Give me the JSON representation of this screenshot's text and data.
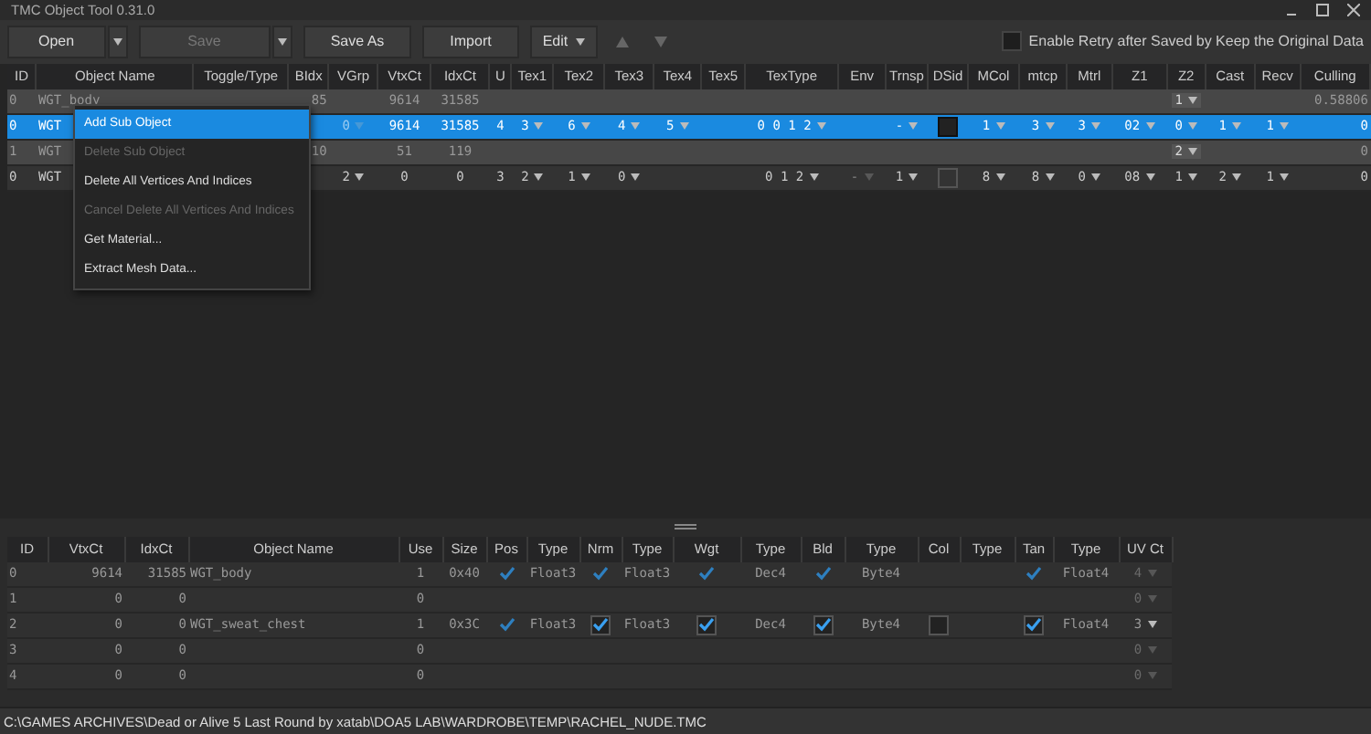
{
  "window": {
    "title": "TMC Object Tool 0.31.0"
  },
  "toolbar": {
    "buttons": [
      {
        "label": "Open",
        "disabled": false,
        "dropdown": true
      },
      {
        "label": "Save",
        "disabled": true,
        "dropdown": true
      },
      {
        "label": "Save As",
        "disabled": false,
        "dropdown": false
      },
      {
        "label": "Import",
        "disabled": false,
        "dropdown": false
      },
      {
        "label": "Edit",
        "disabled": false,
        "dropdown": true,
        "kind": "menu"
      }
    ],
    "retry_option": {
      "label": "Enable Retry after Saved by Keep the Original Data",
      "checked": false
    }
  },
  "objects_table": {
    "columns": [
      "ID",
      "Object Name",
      "Toggle/Type",
      "BIdx",
      "VGrp",
      "VtxCt",
      "IdxCt",
      "U",
      "Tex1",
      "Tex2",
      "Tex3",
      "Tex4",
      "Tex5",
      "TexType",
      "Env",
      "Trnsp",
      "DSid",
      "MCol",
      "mtcp",
      "Mtrl",
      "Z1",
      "Z2",
      "Cast",
      "Recv",
      "Culling"
    ],
    "rows": [
      {
        "kind": "object",
        "selected": false,
        "cells": [
          "0",
          "WGT_body",
          null,
          "85",
          null,
          "9614",
          "31585",
          null,
          null,
          null,
          null,
          null,
          null,
          null,
          null,
          null,
          null,
          null,
          null,
          null,
          null,
          {
            "kind": "dropdown",
            "text": "1"
          },
          null,
          null,
          "0.58806"
        ]
      },
      {
        "kind": "sub",
        "selected": true,
        "cells": [
          "0",
          "WGT",
          null,
          null,
          {
            "kind": "dropdown",
            "text": "0",
            "disabled": true
          },
          "9614",
          "31585",
          "4",
          {
            "kind": "dropdown",
            "text": "3"
          },
          {
            "kind": "dropdown",
            "text": "6"
          },
          {
            "kind": "dropdown",
            "text": "4"
          },
          {
            "kind": "dropdown",
            "text": "5"
          },
          null,
          {
            "kind": "dropdown",
            "text": "0 0 1 2"
          },
          null,
          {
            "kind": "dropdown",
            "text": "-"
          },
          {
            "kind": "swatch",
            "filled": true
          },
          {
            "kind": "dropdown",
            "text": "1"
          },
          {
            "kind": "dropdown",
            "text": "3"
          },
          {
            "kind": "dropdown",
            "text": "3"
          },
          {
            "kind": "dropdown",
            "text": "02"
          },
          {
            "kind": "dropdown",
            "text": "0"
          },
          {
            "kind": "dropdown",
            "text": "1"
          },
          {
            "kind": "dropdown",
            "text": "1"
          },
          "0"
        ]
      },
      {
        "kind": "object",
        "selected": false,
        "cells": [
          "1",
          "WGT",
          null,
          "10",
          null,
          "51",
          "119",
          null,
          null,
          null,
          null,
          null,
          null,
          null,
          null,
          null,
          null,
          null,
          null,
          null,
          null,
          {
            "kind": "dropdown",
            "text": "2"
          },
          null,
          null,
          "0"
        ]
      },
      {
        "kind": "sub",
        "selected": false,
        "cells": [
          "0",
          "WGT",
          null,
          null,
          {
            "kind": "dropdown",
            "text": "2"
          },
          "0",
          "0",
          "3",
          {
            "kind": "dropdown",
            "text": "2"
          },
          {
            "kind": "dropdown",
            "text": "1"
          },
          {
            "kind": "dropdown",
            "text": "0"
          },
          null,
          null,
          {
            "kind": "dropdown",
            "text": "0 1 2"
          },
          {
            "kind": "dropdown",
            "text": "-",
            "disabled": true
          },
          {
            "kind": "dropdown",
            "text": "1"
          },
          {
            "kind": "swatch",
            "filled": false
          },
          {
            "kind": "dropdown",
            "text": "8"
          },
          {
            "kind": "dropdown",
            "text": "8"
          },
          {
            "kind": "dropdown",
            "text": "0"
          },
          {
            "kind": "dropdown",
            "text": "08"
          },
          {
            "kind": "dropdown",
            "text": "1"
          },
          {
            "kind": "dropdown",
            "text": "2"
          },
          {
            "kind": "dropdown",
            "text": "1"
          },
          "0"
        ]
      }
    ]
  },
  "context_menu": {
    "items": [
      {
        "label": "Add Sub Object",
        "disabled": false,
        "selected": true
      },
      {
        "label": "Delete Sub Object",
        "disabled": true,
        "selected": false
      },
      {
        "label": "Delete All Vertices And Indices",
        "disabled": false,
        "selected": false
      },
      {
        "label": "Cancel Delete All Vertices And Indices",
        "disabled": true,
        "selected": false
      },
      {
        "label": "Get Material...",
        "disabled": false,
        "selected": false
      },
      {
        "label": "Extract Mesh Data...",
        "disabled": false,
        "selected": false
      }
    ]
  },
  "meshes_table": {
    "columns": [
      "ID",
      "VtxCt",
      "IdxCt",
      "Object Name",
      "Use",
      "Size",
      "Pos",
      "Type",
      "Nrm",
      "Type",
      "Wgt",
      "Type",
      "Bld",
      "Type",
      "Col",
      "Type",
      "Tan",
      "Type",
      "UV Ct"
    ],
    "rows": [
      {
        "cells": [
          "0",
          "9614",
          "31585",
          "WGT_body",
          "1",
          "0x40",
          {
            "kind": "check",
            "checked": true,
            "boxed": false
          },
          "Float3",
          {
            "kind": "check",
            "checked": true,
            "boxed": false
          },
          "Float3",
          {
            "kind": "check",
            "checked": true,
            "boxed": false
          },
          "Dec4",
          {
            "kind": "check",
            "checked": true,
            "boxed": false
          },
          "Byte4",
          null,
          null,
          {
            "kind": "check",
            "checked": true,
            "boxed": false
          },
          "Float4",
          {
            "kind": "dropdown",
            "text": "4",
            "disabled": true
          }
        ]
      },
      {
        "cells": [
          "1",
          "0",
          "0",
          null,
          "0",
          null,
          null,
          null,
          null,
          null,
          null,
          null,
          null,
          null,
          null,
          null,
          null,
          null,
          {
            "kind": "dropdown",
            "text": "0",
            "disabled": true
          }
        ]
      },
      {
        "cells": [
          "2",
          "0",
          "0",
          "WGT_sweat_chest",
          "1",
          "0x3C",
          {
            "kind": "check",
            "checked": true,
            "boxed": false
          },
          "Float3",
          {
            "kind": "check",
            "checked": true,
            "boxed": true
          },
          "Float3",
          {
            "kind": "check",
            "checked": true,
            "boxed": true
          },
          "Dec4",
          {
            "kind": "check",
            "checked": true,
            "boxed": true
          },
          "Byte4",
          {
            "kind": "check",
            "checked": false,
            "boxed": true
          },
          null,
          {
            "kind": "check",
            "checked": true,
            "boxed": true
          },
          "Float4",
          {
            "kind": "dropdown",
            "text": "3",
            "disabled": false
          }
        ]
      },
      {
        "cells": [
          "3",
          "0",
          "0",
          null,
          "0",
          null,
          null,
          null,
          null,
          null,
          null,
          null,
          null,
          null,
          null,
          null,
          null,
          null,
          {
            "kind": "dropdown",
            "text": "0",
            "disabled": true
          }
        ]
      },
      {
        "cells": [
          "4",
          "0",
          "0",
          null,
          "0",
          null,
          null,
          null,
          null,
          null,
          null,
          null,
          null,
          null,
          null,
          null,
          null,
          null,
          {
            "kind": "dropdown",
            "text": "0",
            "disabled": true
          }
        ]
      }
    ]
  },
  "status_bar": {
    "path": "C:\\GAMES ARCHIVES\\Dead or Alive 5 Last Round by xatab\\DOA5 LAB\\WARDROBE\\TEMP\\RACHEL_NUDE.TMC"
  }
}
